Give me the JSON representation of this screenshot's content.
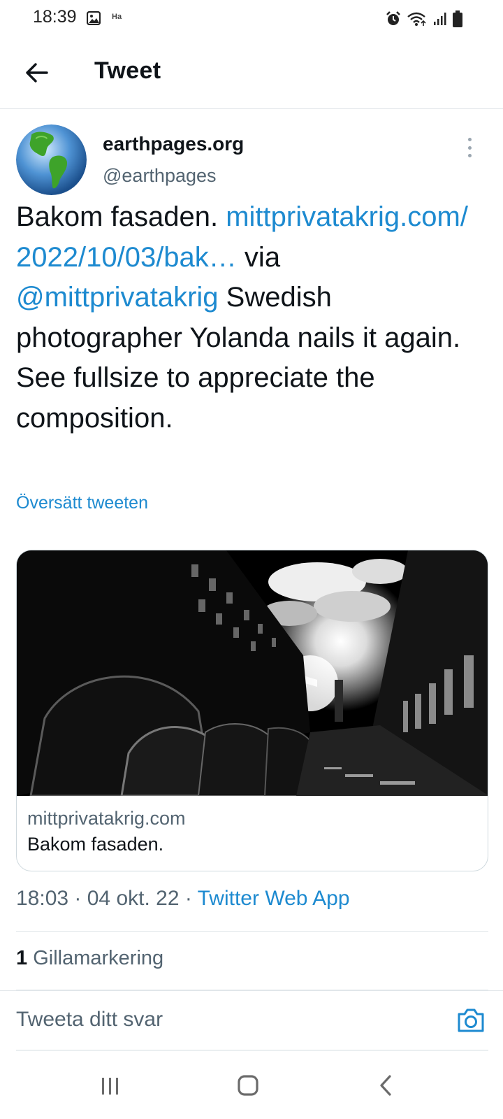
{
  "status_bar": {
    "time": "18:39",
    "notification_text": "Ha",
    "icons": [
      "gallery-icon",
      "alarm-icon",
      "wifi-icon",
      "signal-icon",
      "battery-icon"
    ]
  },
  "header": {
    "title": "Tweet",
    "back_icon": "arrow-left-icon"
  },
  "tweet": {
    "author_name": "earthpages.org",
    "author_handle": "@earthpages",
    "more_icon": "more-vertical-icon",
    "text_1": "Bakom fasaden. ",
    "link_url": "mittprivatakrig.com/​2022/10/03/bak…",
    "text_2": " via ",
    "mention": "@mittprivatakrig",
    "text_3": " Swedish photographer Yolanda nails it again. See fullsize to appreciate the composition.",
    "translate_label": "Översätt tweeten",
    "card": {
      "domain": "mittprivatakrig.com",
      "title": "Bakom fasaden."
    },
    "time": "18:03",
    "separator": " · ",
    "date": "04 okt. 22",
    "source": "Twitter Web App",
    "like_count": "1",
    "like_label": " Gillamarkering"
  },
  "reply": {
    "placeholder": "Tweeta ditt svar",
    "camera_icon": "camera-icon"
  },
  "nav": {
    "icons": [
      "recent-apps-icon",
      "home-icon",
      "back-icon"
    ]
  },
  "colors": {
    "link": "#1d8ad0",
    "text": "#0f1419",
    "secondary": "#536471",
    "divider": "#e1e6ea"
  }
}
